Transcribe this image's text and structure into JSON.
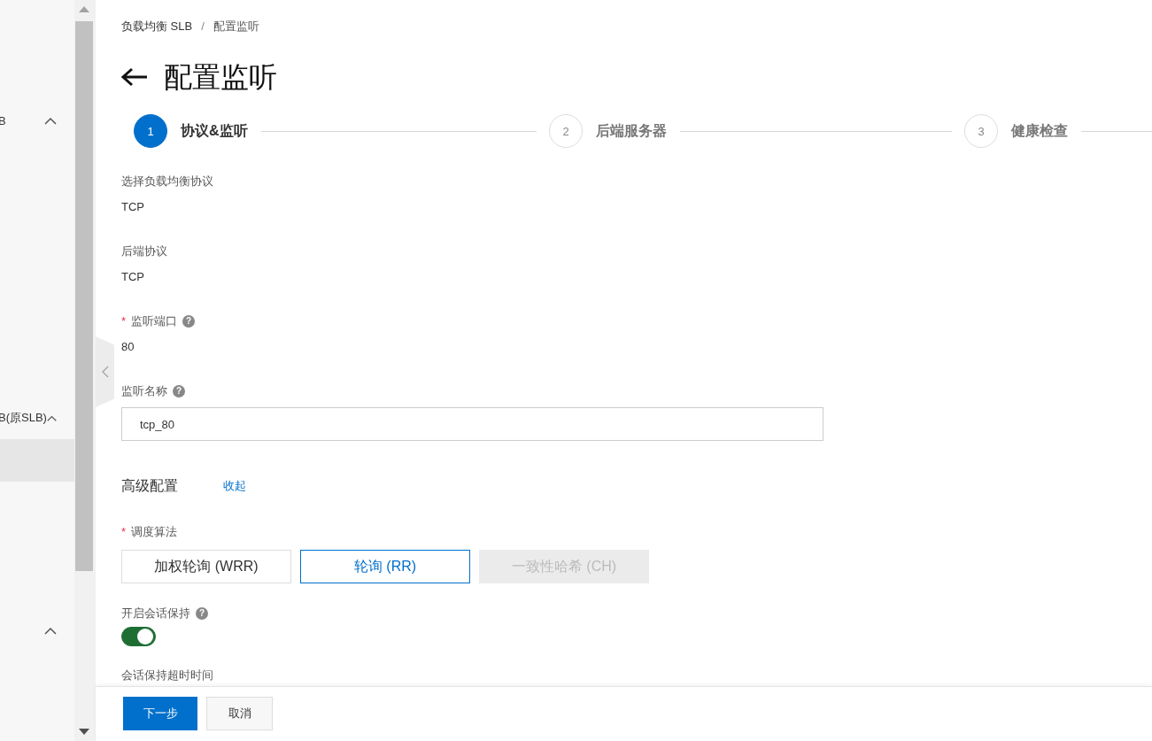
{
  "sidebar": {
    "items": [
      {
        "label": "B",
        "expanded": true,
        "selected": false
      },
      {
        "label": "B(原SLB)",
        "expanded": true,
        "selected": false
      },
      {
        "selected": true
      },
      {
        "expanded": true,
        "selected": false
      }
    ]
  },
  "breadcrumb": {
    "items": [
      "负载均衡 SLB",
      "配置监听"
    ],
    "separator": "/"
  },
  "title": "配置监听",
  "steps": [
    {
      "number": "1",
      "label": "协议&监听",
      "selected": true
    },
    {
      "number": "2",
      "label": "后端服务器",
      "selected": false
    },
    {
      "number": "3",
      "label": "健康检查",
      "selected": false
    }
  ],
  "fields": [
    {
      "kind": "static",
      "label": "选择负载均衡协议",
      "value": "TCP"
    },
    {
      "kind": "static",
      "label": "后端协议",
      "value": "TCP"
    },
    {
      "kind": "static",
      "label": "监听端口",
      "required_mark": "*",
      "help_icon": "?",
      "value": "80"
    },
    {
      "kind": "input",
      "label": "监听名称",
      "help_icon": "?",
      "value": "tcp_80"
    },
    {
      "kind": "section",
      "label": "高级配置",
      "link": "收起"
    },
    {
      "kind": "choice",
      "label": "调度算法",
      "required_mark": "*",
      "options": [
        {
          "label": "加权轮询 (WRR)",
          "selected": false,
          "disabled": false
        },
        {
          "label": "轮询 (RR)",
          "selected": true,
          "disabled": false
        },
        {
          "label": "一致性哈希 (CH)",
          "selected": false,
          "disabled": true
        }
      ]
    },
    {
      "kind": "toggle",
      "label": "开启会话保持",
      "help_icon": "?",
      "on": true
    },
    {
      "kind": "static",
      "label": "会话保持超时时间"
    }
  ],
  "footer": {
    "buttons": [
      {
        "label": "下一步",
        "kind": "primary"
      },
      {
        "label": "取消",
        "kind": "default"
      }
    ]
  }
}
